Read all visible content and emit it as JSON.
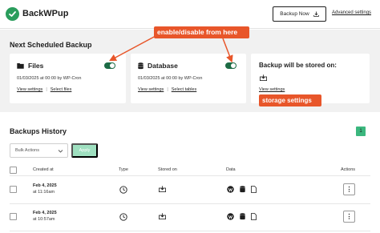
{
  "header": {
    "brand": "BackWPup",
    "backup_now_label": "Backup Now",
    "advanced_settings_label": "Advanced settings",
    "logo_icon": "checkmark-logo-icon",
    "brand_color": "#2a9d5c"
  },
  "scheduled": {
    "title": "Next Scheduled Backup",
    "files": {
      "title": "Files",
      "icon": "folder-icon",
      "schedule": "01/03/2025 at 00:00 by WP-Cron",
      "view_settings": "View settings",
      "separator": "|",
      "select_link": "Select files",
      "enabled": true
    },
    "database": {
      "title": "Database",
      "icon": "database-icon",
      "schedule": "01/03/2025 at 00:00 by WP-Cron",
      "view_settings": "View settings",
      "separator": "|",
      "select_link": "Select tables",
      "enabled": true
    },
    "storage": {
      "title": "Backup will be stored on:",
      "icon": "download-to-folder-icon",
      "view_settings": "View settings"
    }
  },
  "annotations": {
    "enable_disable": "enable/disable from here",
    "storage_settings": "storage settings",
    "color": "#e8562a"
  },
  "history": {
    "title": "Backups History",
    "page": "1",
    "bulk_actions_label": "Bulk Actions",
    "apply_label": "Apply",
    "columns": {
      "created_at": "Created at",
      "type": "Type",
      "stored_on": "Stored on",
      "data": "Data",
      "actions": "Actions"
    },
    "rows": [
      {
        "date": "Feb 4, 2025",
        "time": "at 11:16am",
        "type_icon": "clock-icon",
        "stored_icon": "download-to-folder-icon",
        "data_icons": [
          "wordpress-icon",
          "database-icon",
          "file-icon"
        ],
        "action": "⋮"
      },
      {
        "date": "Feb 4, 2025",
        "time": "at 10:57am",
        "type_icon": "clock-icon",
        "stored_icon": "download-to-folder-icon",
        "data_icons": [
          "wordpress-icon",
          "database-icon",
          "file-icon"
        ],
        "action": "⋮"
      }
    ]
  }
}
